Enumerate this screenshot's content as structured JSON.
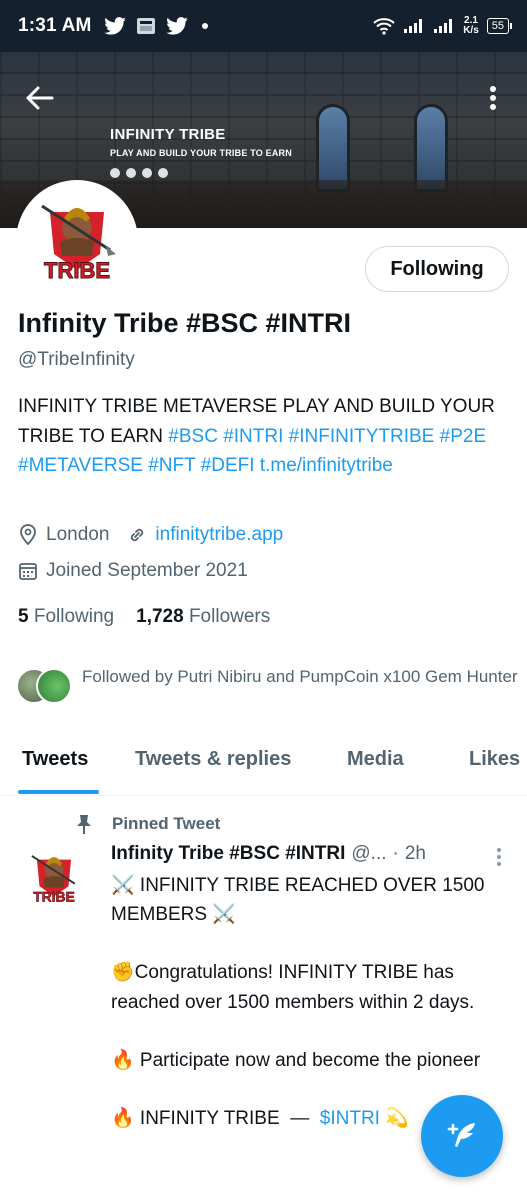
{
  "status_bar": {
    "time": "1:31 AM",
    "speed_value": "2.1",
    "speed_unit": "K/s",
    "battery": "55"
  },
  "banner": {
    "title": "INFINITY TRIBE",
    "subtitle": "PLAY AND BUILD YOUR TRIBE TO EARN"
  },
  "avatar_logo_text": "TRIBE",
  "profile": {
    "follow_button_label": "Following",
    "name": "Infinity Tribe #BSC #INTRI",
    "handle": "@TribeInfinity",
    "bio_text": "INFINITY TRIBE METAVERSE PLAY AND BUILD YOUR TRIBE TO EARN ",
    "bio_hashtags": [
      "#BSC",
      "#INTRI",
      "#INFINITYTRIBE",
      "#P2E",
      "#METAVERSE",
      "#NFT",
      "#DEFI"
    ],
    "bio_link": "t.me/infinitytribe",
    "location": "London",
    "website": "infinitytribe.app",
    "joined": "Joined September 2021",
    "following_count": "5",
    "following_label": "Following",
    "followers_count": "1,728",
    "followers_label": "Followers",
    "followed_by": "Followed by Putri Nibiru and PumpCoin x100 Gem Hunter"
  },
  "tabs": [
    {
      "label": "Tweets",
      "active": true
    },
    {
      "label": "Tweets & replies",
      "active": false
    },
    {
      "label": "Media",
      "active": false
    },
    {
      "label": "Likes",
      "active": false
    }
  ],
  "pinned_tweet": {
    "pinned_label": "Pinned Tweet",
    "author_name": "Infinity Tribe #BSC #INTRI",
    "author_handle": "@...",
    "separator": "·",
    "time": "2h",
    "line1": "⚔️ INFINITY TRIBE REACHED OVER 1500 MEMBERS ⚔️",
    "line2": "✊Congratulations! INFINITY TRIBE has reached over 1500 members within 2 days.",
    "line3": "🔥 Participate now and become the pioneer",
    "line4_prefix": "🔥 INFINITY TRIBE  —  ",
    "line4_cashtag": "$INTRI",
    "line4_suffix": " 💫"
  },
  "colors": {
    "accent": "#1d9bf0",
    "text_primary": "#0f1419",
    "text_secondary": "#536471",
    "status_bar_bg": "#14202e",
    "logo_red": "#d4212a"
  },
  "icons": [
    "back-arrow-icon",
    "more-vertical-icon",
    "location-pin-icon",
    "link-icon",
    "calendar-icon",
    "pin-icon",
    "compose-tweet-icon",
    "twitter-bird-icon",
    "wifi-icon",
    "signal-icon"
  ]
}
